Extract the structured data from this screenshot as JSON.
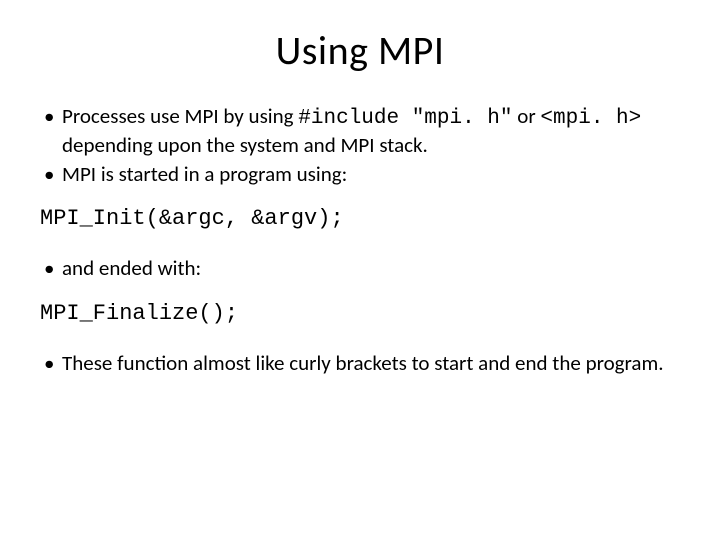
{
  "title": "Using MPI",
  "bullets_a": {
    "b1_pre": "Processes use MPI by using ",
    "b1_code1": "#include \"mpi. h\"",
    "b1_mid": " or ",
    "b1_code2": "<mpi. h>",
    "b1_post": " depending upon the system and MPI stack.",
    "b2": "MPI is started in a program using:"
  },
  "code1": "MPI_Init(&argc, &argv);",
  "bullets_b": {
    "b1": "and ended with:"
  },
  "code2": "MPI_Finalize();",
  "bullets_c": {
    "b1": "These function almost like curly brackets to start and end the program."
  }
}
